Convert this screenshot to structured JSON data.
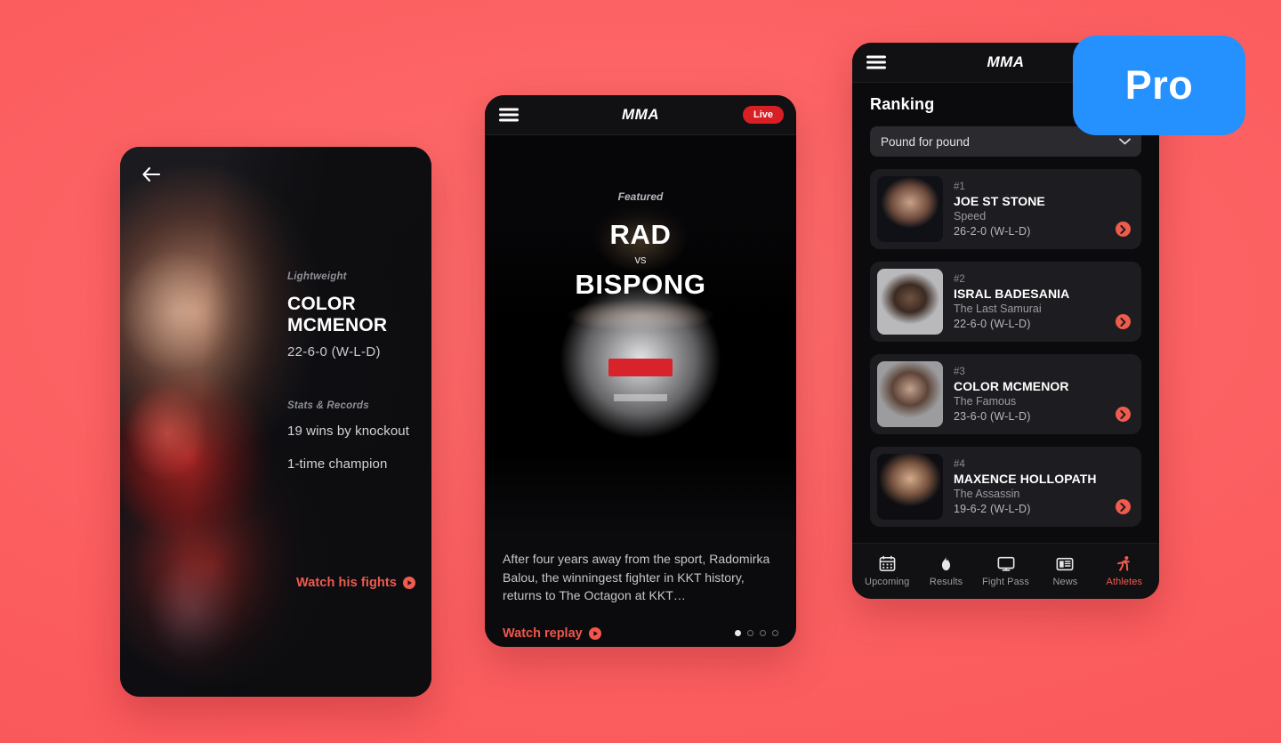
{
  "app": {
    "brand": "MMA"
  },
  "background": {
    "color": "#fb5b5d"
  },
  "pro_badge": {
    "label": "Pro",
    "color": "#2491ff"
  },
  "watermark": {
    "text": ""
  },
  "fighter_detail": {
    "back_icon": "arrow-left-icon",
    "division": "Lightweight",
    "name_line1": "COLOR",
    "name_line2": "MCMENOR",
    "record": "22-6-0 (W-L-D)",
    "stats_heading": "Stats & Records",
    "stats": [
      "19 wins by knockout",
      "1-time champion"
    ],
    "cta": "Watch his fights",
    "cta_icon": "play-circle-icon"
  },
  "featured": {
    "menu_icon": "hamburger-menu-icon",
    "brand": "MMA",
    "live_label": "Live",
    "label": "Featured",
    "fighter_a": "RAD",
    "separator": "vs",
    "fighter_b": "BISPONG",
    "description": "After four years away from the sport, Radomirka Balou, the winningest fighter in KKT history, returns to The Octagon at KKT…",
    "cta": "Watch replay",
    "cta_icon": "play-circle-icon",
    "pagination": {
      "total": 4,
      "active": 1
    }
  },
  "ranking": {
    "menu_icon": "hamburger-menu-icon",
    "brand": "MMA",
    "heading": "Ranking",
    "filter_value": "Pound for pound",
    "filter_icon": "chevron-down-icon",
    "chevron_icon": "chevron-right-icon",
    "items": [
      {
        "rank": "#1",
        "name": "JOE ST STONE",
        "nickname": "Speed",
        "record": "26-2-0 (W-L-D)"
      },
      {
        "rank": "#2",
        "name": "ISRAL BADESANIA",
        "nickname": "The Last Samurai",
        "record": "22-6-0 (W-L-D)"
      },
      {
        "rank": "#3",
        "name": "COLOR MCMENOR",
        "nickname": "The Famous",
        "record": "23-6-0 (W-L-D)"
      },
      {
        "rank": "#4",
        "name": "MAXENCE HOLLOPATH",
        "nickname": "The Assassin",
        "record": "19-6-2 (W-L-D)"
      }
    ],
    "tabs": [
      {
        "label": "Upcoming",
        "icon": "calendar-icon",
        "active": false
      },
      {
        "label": "Results",
        "icon": "flame-icon",
        "active": false
      },
      {
        "label": "Fight Pass",
        "icon": "monitor-icon",
        "active": false
      },
      {
        "label": "News",
        "icon": "newspaper-icon",
        "active": false
      },
      {
        "label": "Athletes",
        "icon": "runner-icon",
        "active": true
      }
    ]
  }
}
